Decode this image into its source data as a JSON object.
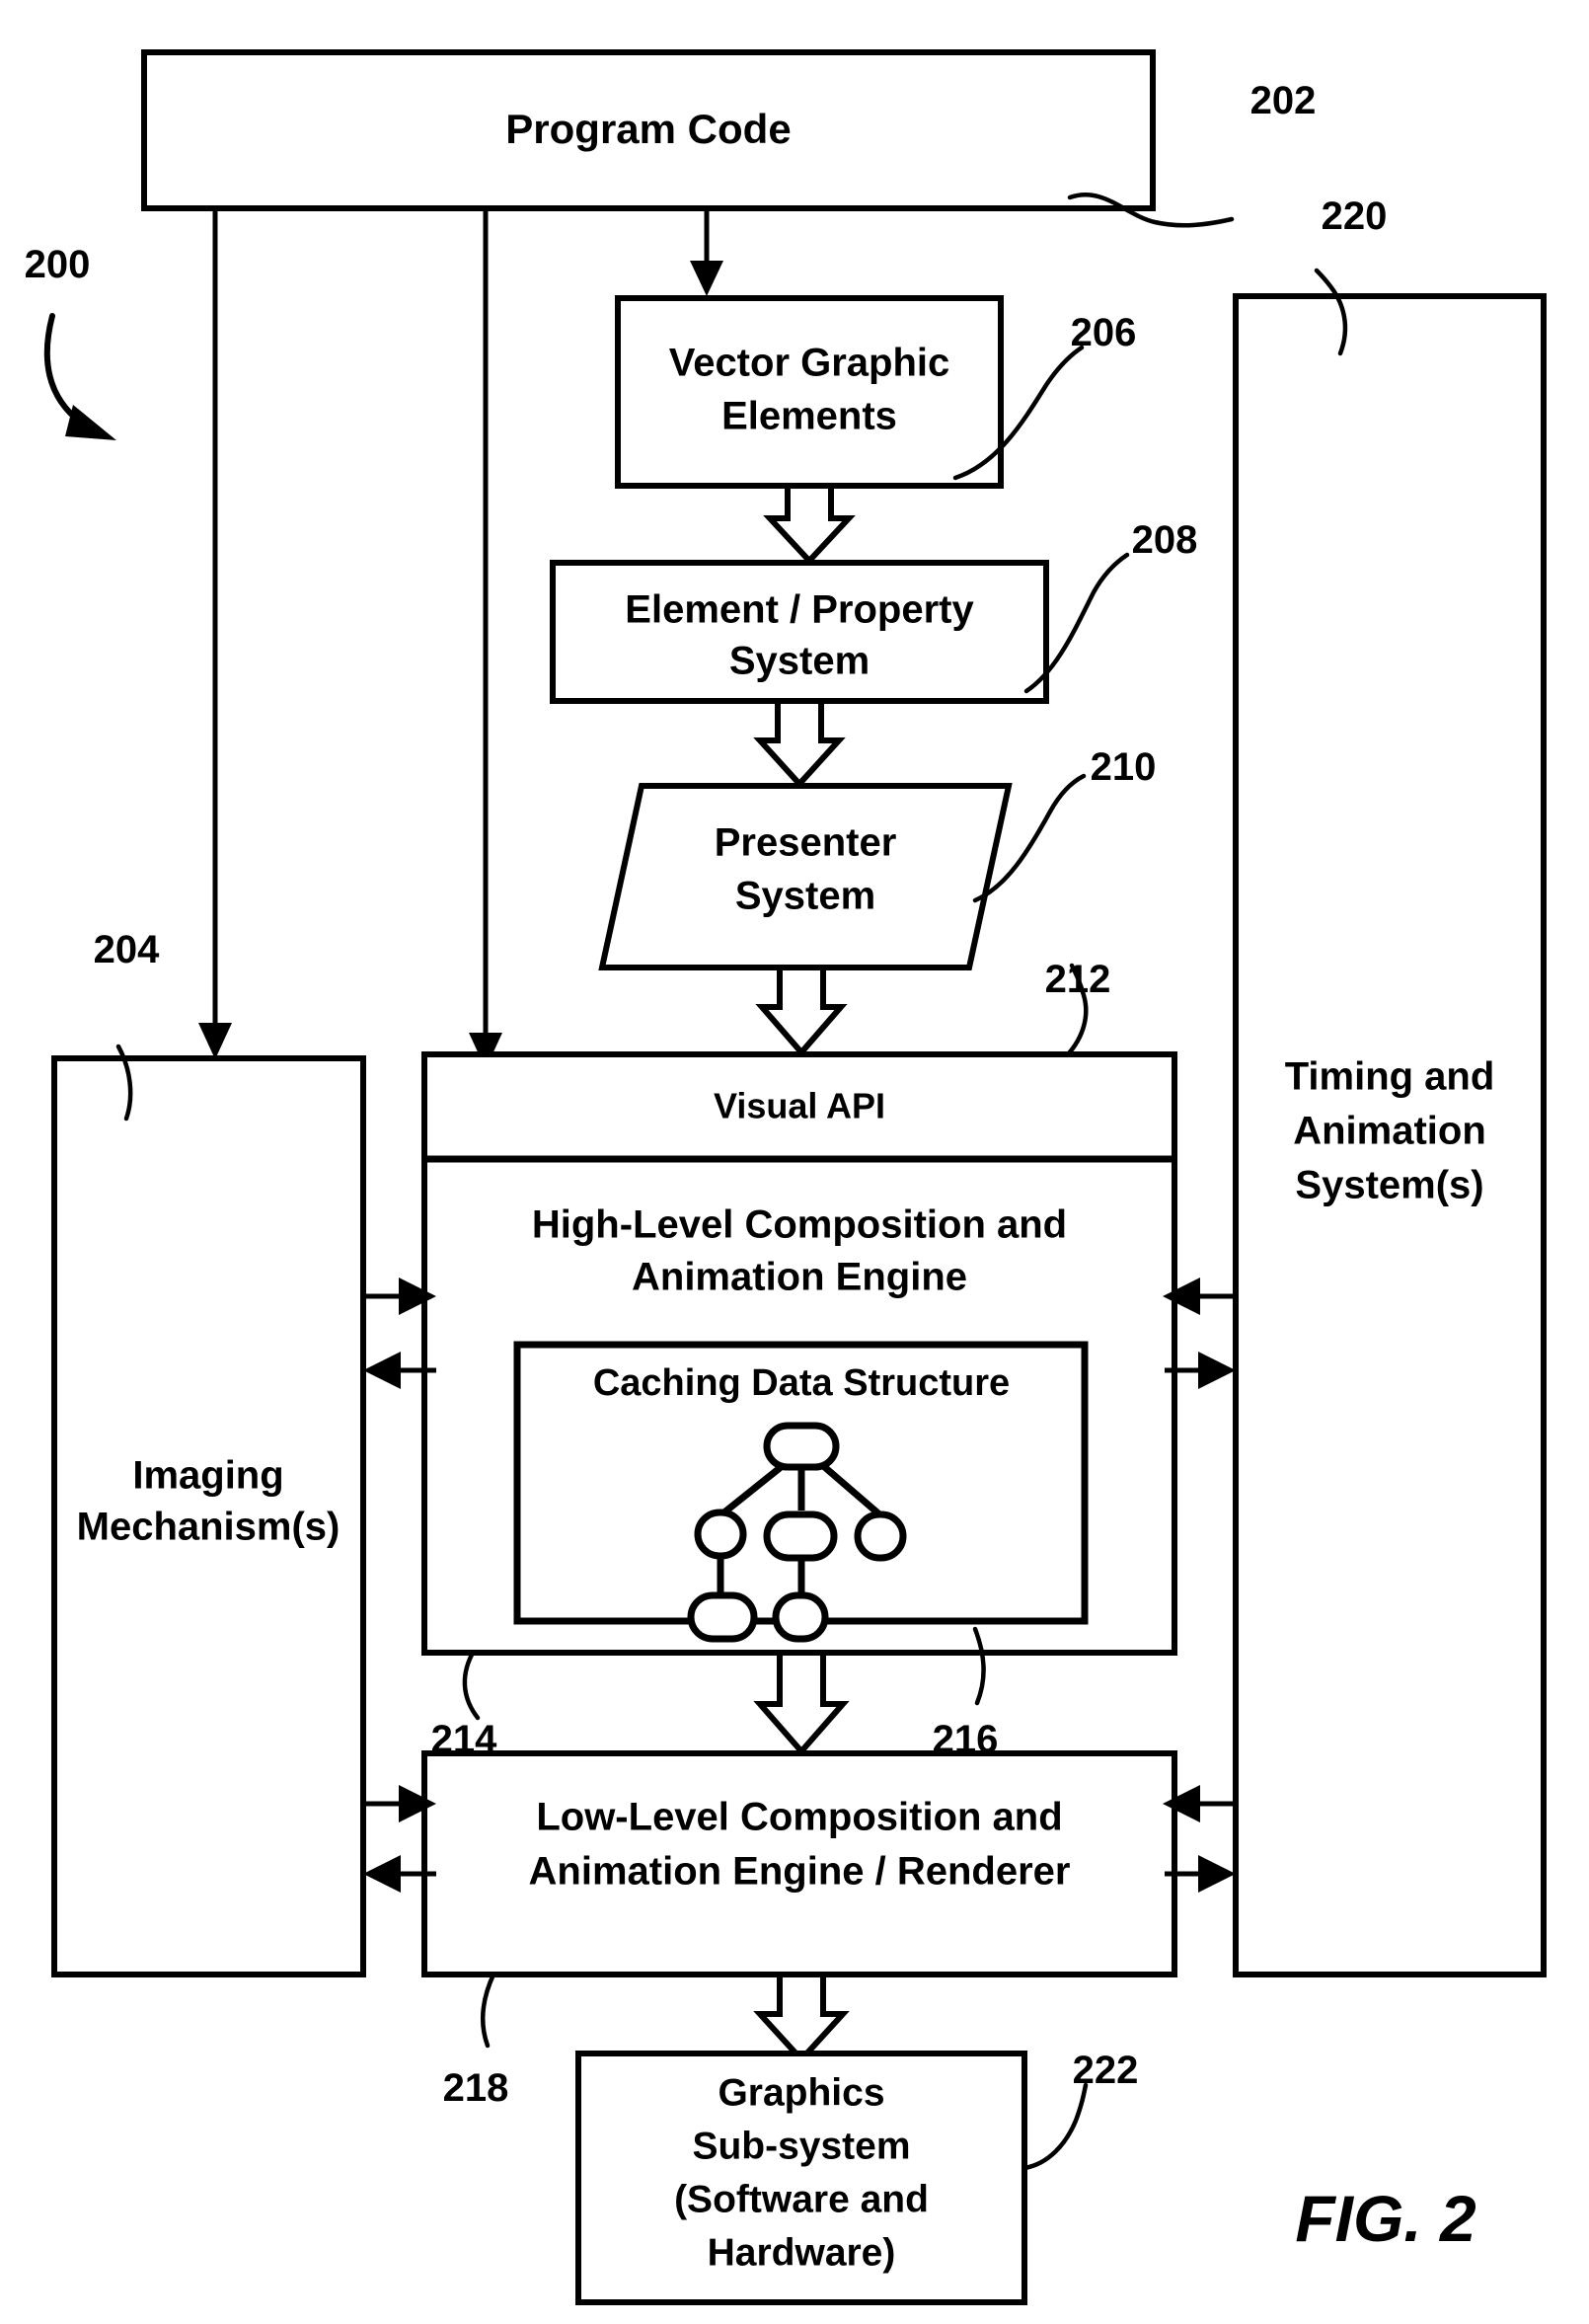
{
  "figure": {
    "caption": "FIG. 2",
    "overall_ref": "200"
  },
  "nodes": [
    {
      "id": "program-code",
      "label": "Program Code",
      "ref": "202",
      "shape": "rect"
    },
    {
      "id": "imaging-mechanisms",
      "label": "Imaging\nMechanism(s)",
      "ref": "204",
      "shape": "rect"
    },
    {
      "id": "vector-graphic",
      "label": "Vector Graphic\nElements",
      "ref": "206",
      "shape": "rect"
    },
    {
      "id": "element-property",
      "label": "Element / Property\nSystem",
      "ref": "208",
      "shape": "rect"
    },
    {
      "id": "presenter-system",
      "label": "Presenter\nSystem",
      "ref": "210",
      "shape": "parallelogram"
    },
    {
      "id": "visual-api",
      "label": "Visual API",
      "ref": "212",
      "shape": "rect"
    },
    {
      "id": "high-level-engine",
      "label": "High-Level Composition and\nAnimation Engine",
      "ref": "214",
      "shape": "rect"
    },
    {
      "id": "caching-structure",
      "label": "Caching Data Structure",
      "ref": "216",
      "shape": "rect"
    },
    {
      "id": "low-level-engine",
      "label": "Low-Level Composition and\nAnimation Engine / Renderer",
      "ref": "218",
      "shape": "rect"
    },
    {
      "id": "timing-animation",
      "label": "Timing and\nAnimation\nSystem(s)",
      "ref": "220",
      "shape": "rect"
    },
    {
      "id": "graphics-subsystem",
      "label": "Graphics\nSub-system\n(Software and\nHardware)",
      "ref": "222",
      "shape": "rect"
    }
  ],
  "node_text": {
    "program_code": "Program Code",
    "imaging_line1": "Imaging",
    "imaging_line2": "Mechanism(s)",
    "vector_line1": "Vector Graphic",
    "vector_line2": "Elements",
    "element_line1": "Element / Property",
    "element_line2": "System",
    "presenter_line1": "Presenter",
    "presenter_line2": "System",
    "visual_api": "Visual API",
    "highlevel_line1": "High-Level Composition and",
    "highlevel_line2": "Animation Engine",
    "caching": "Caching Data Structure",
    "lowlevel_line1": "Low-Level Composition and",
    "lowlevel_line2": "Animation Engine / Renderer",
    "timing_line1": "Timing and",
    "timing_line2": "Animation",
    "timing_line3": "System(s)",
    "graphics_line1": "Graphics",
    "graphics_line2": "Sub-system",
    "graphics_line3": "(Software and",
    "graphics_line4": "Hardware)"
  },
  "refs": {
    "r200": "200",
    "r202": "202",
    "r204": "204",
    "r206": "206",
    "r208": "208",
    "r210": "210",
    "r212": "212",
    "r214": "214",
    "r216": "216",
    "r218": "218",
    "r220": "220",
    "r222": "222"
  },
  "colors": {
    "ink": "#000000",
    "paper": "#ffffff"
  },
  "chart_data": {
    "type": "diagram",
    "title": "FIG. 2",
    "nodes": [
      "Program Code (202)",
      "Imaging Mechanism(s) (204)",
      "Vector Graphic Elements (206)",
      "Element / Property System (208)",
      "Presenter System (210)",
      "Visual API (212)",
      "High-Level Composition and Animation Engine (214)",
      "Caching Data Structure (216)",
      "Low-Level Composition and Animation Engine / Renderer (218)",
      "Timing and Animation System(s) (220)",
      "Graphics Sub-system (Software and Hardware) (222)"
    ],
    "edges": [
      {
        "from": "Program Code",
        "to": "Imaging Mechanism(s)",
        "style": "solid-arrow"
      },
      {
        "from": "Program Code",
        "to": "Visual API",
        "style": "solid-arrow"
      },
      {
        "from": "Program Code",
        "to": "Vector Graphic Elements",
        "style": "solid-arrow"
      },
      {
        "from": "Vector Graphic Elements",
        "to": "Element / Property System",
        "style": "hollow-arrow"
      },
      {
        "from": "Element / Property System",
        "to": "Presenter System",
        "style": "hollow-arrow"
      },
      {
        "from": "Presenter System",
        "to": "Visual API",
        "style": "hollow-arrow"
      },
      {
        "from": "High-Level Composition and Animation Engine",
        "to": "Low-Level Composition and Animation Engine / Renderer",
        "style": "hollow-arrow"
      },
      {
        "from": "Low-Level Composition and Animation Engine / Renderer",
        "to": "Graphics Sub-system",
        "style": "hollow-arrow"
      },
      {
        "from": "Imaging Mechanism(s)",
        "to": "High-Level Composition and Animation Engine",
        "style": "bidirectional"
      },
      {
        "from": "Imaging Mechanism(s)",
        "to": "Low-Level Composition and Animation Engine / Renderer",
        "style": "bidirectional"
      },
      {
        "from": "Timing and Animation System(s)",
        "to": "High-Level Composition and Animation Engine",
        "style": "bidirectional"
      },
      {
        "from": "Timing and Animation System(s)",
        "to": "Low-Level Composition and Animation Engine / Renderer",
        "style": "bidirectional"
      }
    ]
  }
}
